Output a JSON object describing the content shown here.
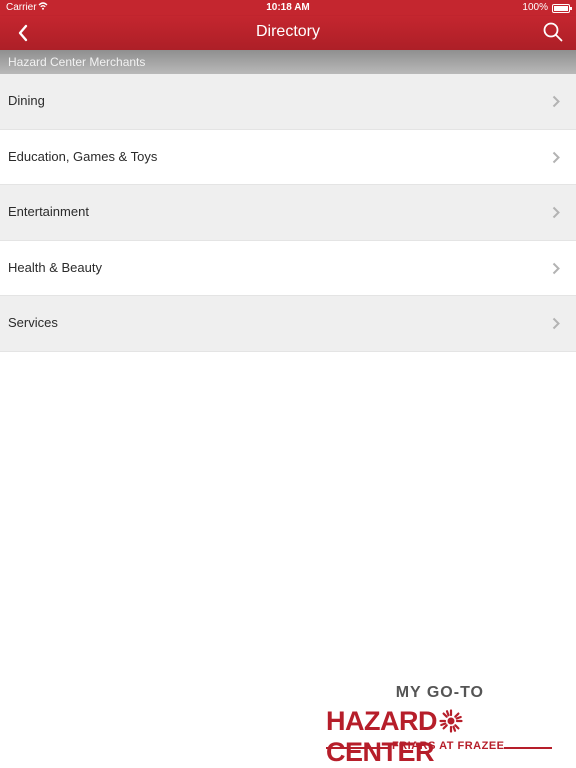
{
  "status_bar": {
    "carrier": "Carrier",
    "time": "10:18 AM",
    "battery": "100%"
  },
  "nav": {
    "title": "Directory",
    "back_icon": "chevron-left-icon",
    "search_icon": "search-icon"
  },
  "section_header": "Hazard Center Merchants",
  "directory": {
    "items": [
      {
        "label": "Dining"
      },
      {
        "label": "Education, Games & Toys"
      },
      {
        "label": "Entertainment"
      },
      {
        "label": "Health & Beauty"
      },
      {
        "label": "Services"
      }
    ]
  },
  "logo": {
    "top": "MY GO-TO",
    "left": "HAZARD",
    "right": "CENTER",
    "bottom": "FRIARS AT FRAZEE"
  },
  "colors": {
    "brand_red": "#c4262f",
    "row_alt": "#efefef",
    "logo_red": "#b61e2a"
  }
}
